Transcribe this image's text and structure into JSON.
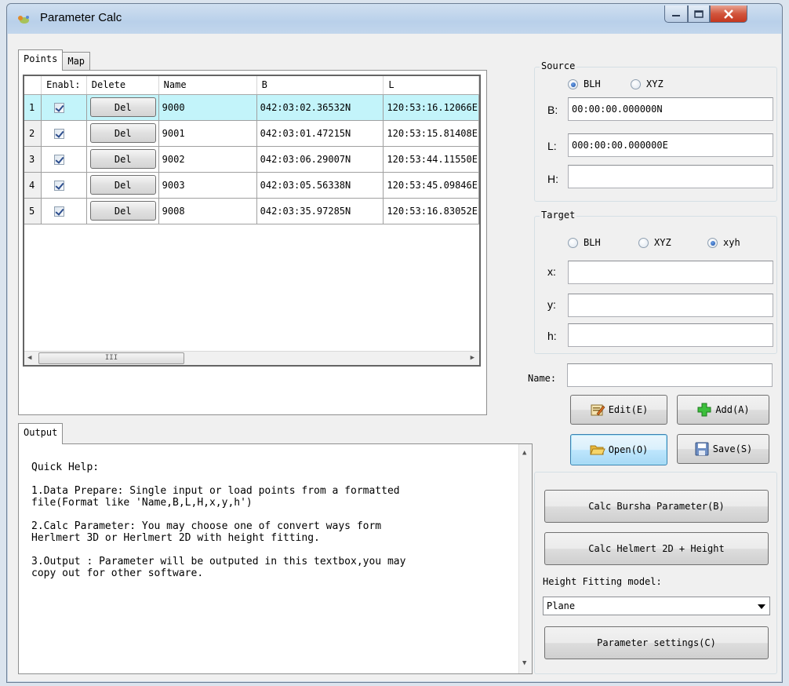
{
  "window": {
    "title": "Parameter Calc"
  },
  "top_tabs": [
    {
      "label": "Points"
    },
    {
      "label": "Map"
    }
  ],
  "grid": {
    "columns": [
      "",
      "Enabl:",
      "Delete",
      "Name",
      "B",
      "L"
    ],
    "rows": [
      {
        "num": "1",
        "enabled": true,
        "del": "Del",
        "name": "9000",
        "b": "042:03:02.36532N",
        "l": "120:53:16.12066E"
      },
      {
        "num": "2",
        "enabled": true,
        "del": "Del",
        "name": "9001",
        "b": "042:03:01.47215N",
        "l": "120:53:15.81408E"
      },
      {
        "num": "3",
        "enabled": true,
        "del": "Del",
        "name": "9002",
        "b": "042:03:06.29007N",
        "l": "120:53:44.11550E"
      },
      {
        "num": "4",
        "enabled": true,
        "del": "Del",
        "name": "9003",
        "b": "042:03:05.56338N",
        "l": "120:53:45.09846E"
      },
      {
        "num": "5",
        "enabled": true,
        "del": "Del",
        "name": "9008",
        "b": "042:03:35.97285N",
        "l": "120:53:16.83052E"
      }
    ],
    "selected_row": 1
  },
  "output_tab": {
    "label": "Output"
  },
  "output_text": "Quick Help:\n\n1.Data Prepare: Single input or load points from a formatted\nfile(Format like 'Name,B,L,H,x,y,h')\n\n2.Calc Parameter: You may choose one of convert ways form\nHerlmert 3D or Herlmert 2D with height fitting.\n\n3.Output : Parameter will be outputed in this textbox,you may\ncopy out for other software.",
  "source": {
    "label": "Source",
    "radios": [
      {
        "label": "BLH",
        "checked": true
      },
      {
        "label": "XYZ",
        "checked": false
      }
    ],
    "fields": [
      {
        "label": "B:",
        "value": "00:00:00.000000N"
      },
      {
        "label": "L:",
        "value": "000:00:00.000000E"
      },
      {
        "label": "H:",
        "value": ""
      }
    ]
  },
  "target": {
    "label": "Target",
    "radios": [
      {
        "label": "BLH",
        "checked": false
      },
      {
        "label": "XYZ",
        "checked": false
      },
      {
        "label": "xyh",
        "checked": true
      }
    ],
    "fields": [
      {
        "label": "x:",
        "value": ""
      },
      {
        "label": "y:",
        "value": ""
      },
      {
        "label": "h:",
        "value": ""
      }
    ]
  },
  "name_field": {
    "label": "Name:",
    "value": ""
  },
  "buttons": {
    "edit": "Edit(E)",
    "add": "Add(A)",
    "open": "Open(O)",
    "save": "Save(S)",
    "calc_bursha": "Calc Bursha Parameter(B)",
    "calc_helmert": "Calc Helmert 2D + Height",
    "parameter_settings": "Parameter settings(C)"
  },
  "height_fitting": {
    "label": "Height Fitting model:",
    "selected": "Plane"
  },
  "scrollbar": {
    "thumb_grip": "III"
  },
  "colors": {
    "selected_row": "#c3f4fa",
    "titlebar": "#b9d0ea",
    "close_button": "#c4371f"
  }
}
